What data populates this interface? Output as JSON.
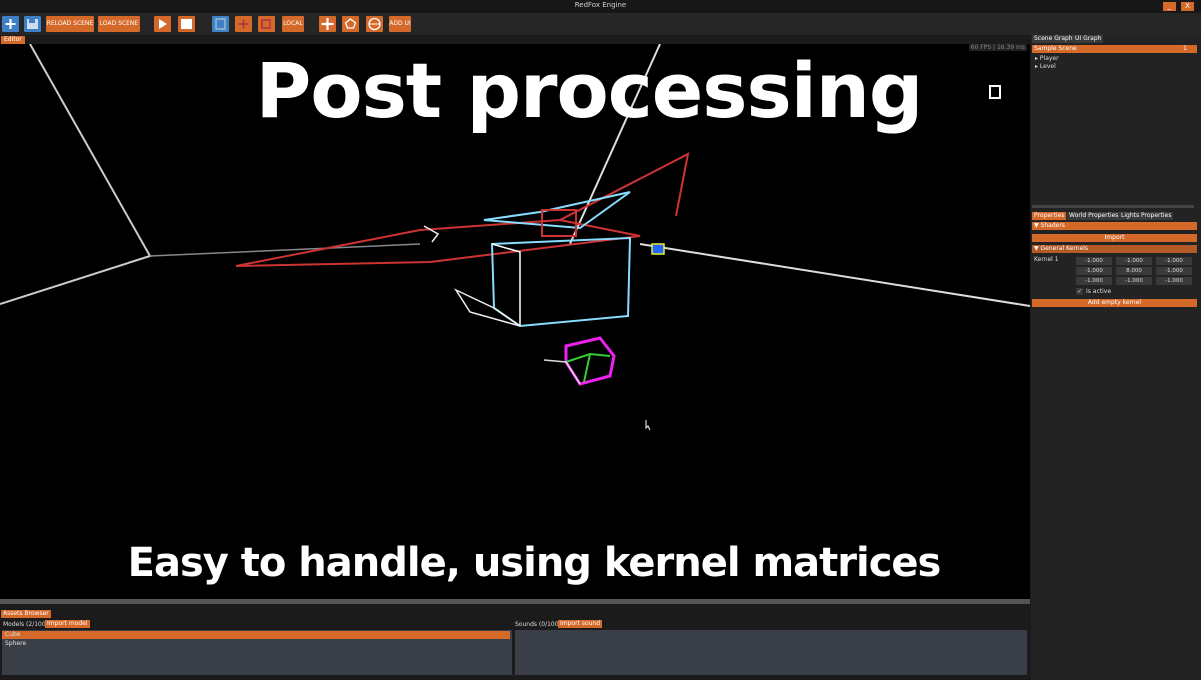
{
  "window": {
    "title": "RedFox Engine",
    "minimize_label": "_",
    "close_label": "X"
  },
  "toolbar": {
    "new_icon": "plus-icon",
    "save_icon": "floppy-disk-icon",
    "reload_scene": "RELOAD SCENE",
    "load_scene": "LOAD SCENE",
    "play_icon": "play-icon",
    "stop_icon": "stop-icon",
    "move_icon": "move-gizmo-icon",
    "rotate_icon": "rotate-gizmo-icon",
    "scale_icon": "scale-gizmo-icon",
    "local": "LOCAL",
    "add_object_icon": "add-object-icon",
    "add_model_icon": "add-model-icon",
    "add_sphere_icon": "add-sphere-icon",
    "add_ui": "ADD UI"
  },
  "editor": {
    "tab_label": "Editor",
    "fps": "60 FPS | 16.39 ms"
  },
  "overlay": {
    "title": "Post processing",
    "subtitle": "Easy to handle, using kernel matrices"
  },
  "scene_graph": {
    "tabs": [
      "Scene Graph",
      "UI Graph"
    ],
    "scene_name": "Sample Scene",
    "scene_count": "1",
    "items": [
      "Player",
      "Level"
    ]
  },
  "properties": {
    "tabs": [
      "Properties",
      "World Properties",
      "Lights Properties"
    ],
    "shaders_header": "Shaders",
    "import_label": "Import",
    "kernels_header": "General Kernels",
    "kernel_label": "Kernel 1",
    "kernel_matrix": [
      [
        "-1.000",
        "-1.000",
        "-1.000"
      ],
      [
        "-1.000",
        "8.000",
        "-1.000"
      ],
      [
        "-1.000",
        "-1.000",
        "-1.000"
      ]
    ],
    "is_active_label": "Is active",
    "add_kernel": "Add empty kernel"
  },
  "assets": {
    "tab_label": "Assets Browser",
    "models_label": "Models (2/100)",
    "import_model": "Import model",
    "models": [
      "Cube",
      "Sphere"
    ],
    "sounds_label": "Sounds (0/100)",
    "import_sound": "Import sound"
  },
  "colors": {
    "accent": "#d4692a",
    "gizmo_blue": "#3f7fc6",
    "panel": "#232323",
    "viewport": "#000000"
  }
}
